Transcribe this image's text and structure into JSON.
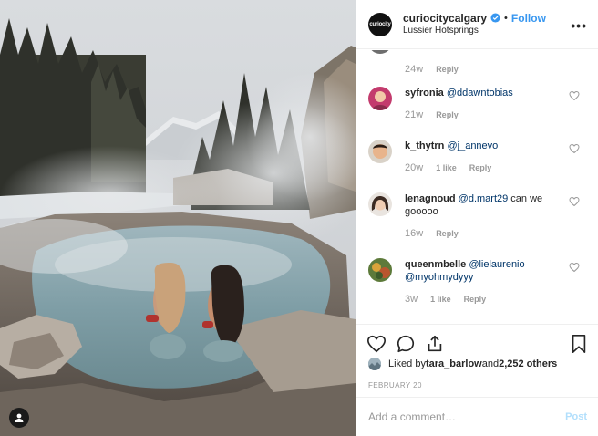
{
  "post": {
    "username": "curiocitycalgary",
    "avatar_text": "curiocity",
    "verified": true,
    "separator": "•",
    "follow_label": "Follow",
    "location": "Lussier Hotsprings",
    "more_label": "•••"
  },
  "comments": [
    {
      "user": "",
      "mention": "",
      "text": "",
      "time": "24w",
      "likes": "",
      "reply": "Reply"
    },
    {
      "user": "syfronia",
      "mention": "@ddawntobias",
      "text": "",
      "time": "21w",
      "likes": "",
      "reply": "Reply"
    },
    {
      "user": "k_thytrn",
      "mention": "@j_annevo",
      "text": "",
      "time": "20w",
      "likes": "1 like",
      "reply": "Reply"
    },
    {
      "user": "lenagnoud",
      "mention": "@d.mart29",
      "text": " can we gooooo",
      "time": "16w",
      "likes": "",
      "reply": "Reply"
    },
    {
      "user": "queenmbelle",
      "mention": "@lielaurenio @myohmydyyy",
      "text": "",
      "time": "3w",
      "likes": "1 like",
      "reply": "Reply"
    }
  ],
  "likes": {
    "prefix": "Liked by ",
    "user": "tara_barlow",
    "middle": " and ",
    "others": "2,252 others"
  },
  "date": "FEBRUARY 20",
  "add_comment": {
    "placeholder": "Add a comment…",
    "post_label": "Post"
  },
  "icons": [
    "heart-icon",
    "comment-icon",
    "share-icon",
    "bookmark-icon",
    "user-tag-icon",
    "verified-badge-icon",
    "more-options-icon"
  ],
  "colors": {
    "accent": "#3897f0",
    "post_disabled": "#b2dffc",
    "muted": "#999999",
    "mention": "#003569"
  }
}
